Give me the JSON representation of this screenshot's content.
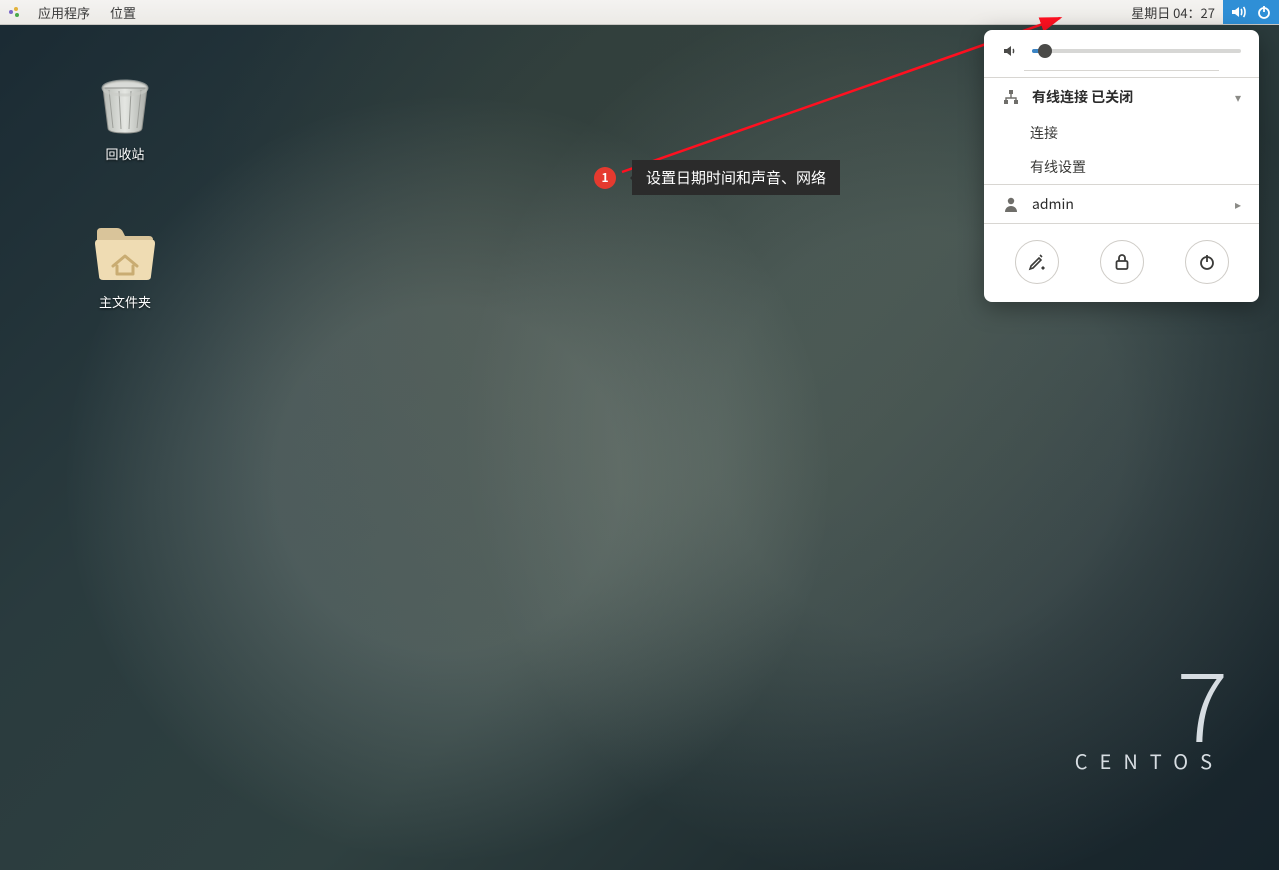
{
  "panel": {
    "applications": "应用程序",
    "places": "位置",
    "clock": "星期日 04：27"
  },
  "desktop_icons": {
    "trash": "回收站",
    "home": "主文件夹"
  },
  "brand": {
    "version": "7",
    "name": "CENTOS"
  },
  "annotation": {
    "number": "1",
    "text": "设置日期时间和声音、网络"
  },
  "popover": {
    "network_title": "有线连接 已关闭",
    "network_connect": "连接",
    "network_settings": "有线设置",
    "user": "admin"
  }
}
